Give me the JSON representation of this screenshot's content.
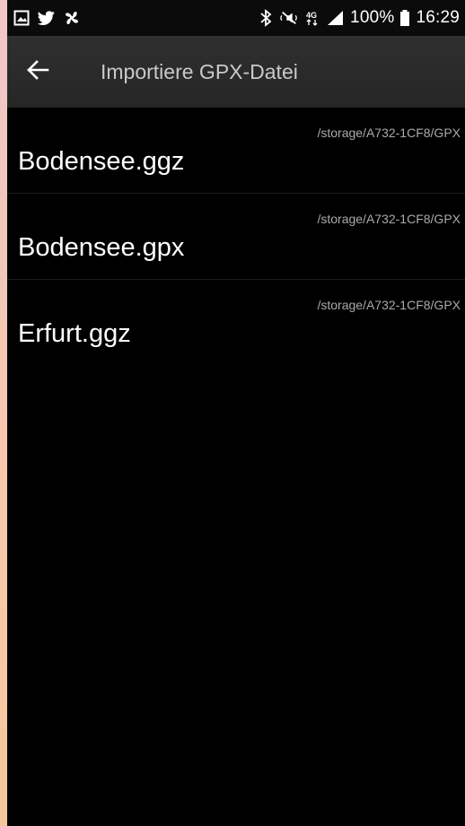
{
  "status_bar": {
    "left_icons": [
      "image-icon",
      "twitter-icon",
      "fan-icon"
    ],
    "right_icons": [
      "bluetooth-icon",
      "mute-icon",
      "network-4g-icon",
      "signal-icon"
    ],
    "battery_pct": "100%",
    "battery_icon": "battery-icon",
    "time": "16:29"
  },
  "app_bar": {
    "back_icon": "arrow-left-icon",
    "title": "Importiere GPX-Datei"
  },
  "files": [
    {
      "name": "Bodensee.ggz",
      "path": "/storage/A732-1CF8/GPX"
    },
    {
      "name": "Bodensee.gpx",
      "path": "/storage/A732-1CF8/GPX"
    },
    {
      "name": "Erfurt.ggz",
      "path": "/storage/A732-1CF8/GPX"
    }
  ],
  "colors": {
    "background": "#000000",
    "app_bar": "#2b2b2b",
    "title_text": "#c9c9c9",
    "path_text": "#aaaaaa",
    "file_text": "#ffffff"
  }
}
